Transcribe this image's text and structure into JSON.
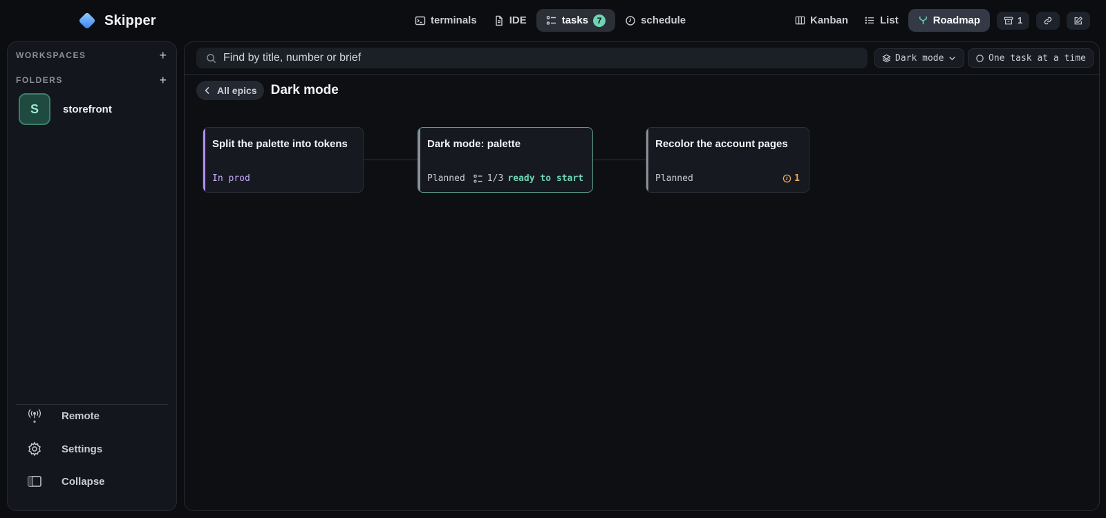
{
  "app": {
    "name": "Skipper"
  },
  "nav": {
    "terminals": "terminals",
    "ide": "IDE",
    "tasks": "tasks",
    "tasks_count": "7",
    "schedule": "schedule"
  },
  "views": {
    "kanban": "Kanban",
    "list": "List",
    "roadmap": "Roadmap",
    "archive_count": "1"
  },
  "sidebar": {
    "workspaces_label": "WORKSPACES",
    "folders_label": "FOLDERS",
    "folder": {
      "initial": "S",
      "name": "storefront"
    },
    "remote": "Remote",
    "settings": "Settings",
    "collapse": "Collapse"
  },
  "toolbar": {
    "search_placeholder": "Find by title, number or brief",
    "epic_filter": "Dark mode",
    "one_task": "One task at a time"
  },
  "breadcrumb": {
    "back": "All epics",
    "title": "Dark mode"
  },
  "cards": [
    {
      "title": "Split the palette into tokens",
      "status": "In prod",
      "status_color": "#c9a7ff",
      "stripe_color": "#b48cf5"
    },
    {
      "title": "Dark mode: palette",
      "status": "Planned",
      "progress": "1/3",
      "ready": "ready to start",
      "stripe_color": "#8b909a"
    },
    {
      "title": "Recolor the account pages",
      "status": "Planned",
      "warning_count": "1",
      "stripe_color": "#8b909a"
    }
  ],
  "colors": {
    "accent": "#6fd4b4",
    "background": "#0b0d11",
    "warning": "#f0a85a"
  }
}
